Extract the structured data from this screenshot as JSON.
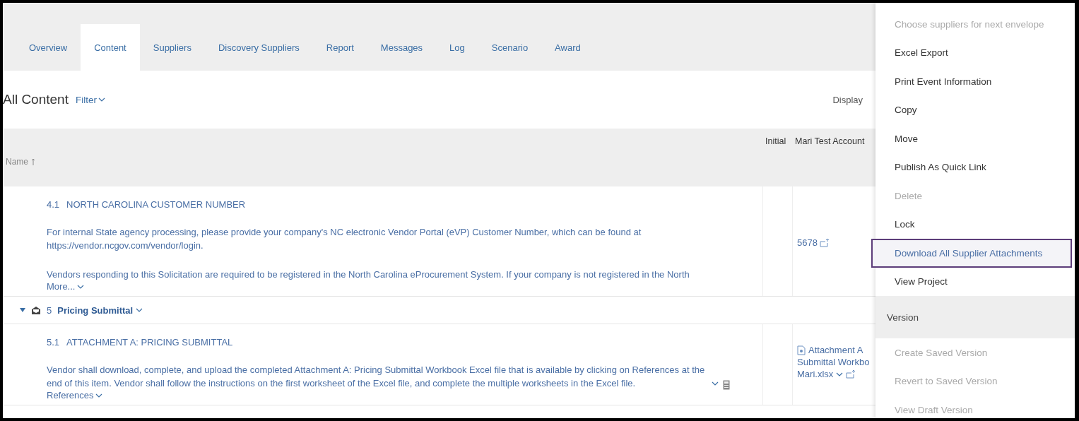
{
  "tabs": [
    {
      "label": "Overview",
      "selected": false
    },
    {
      "label": "Content",
      "selected": true
    },
    {
      "label": "Suppliers",
      "selected": false
    },
    {
      "label": "Discovery Suppliers",
      "selected": false
    },
    {
      "label": "Report",
      "selected": false
    },
    {
      "label": "Messages",
      "selected": false
    },
    {
      "label": "Log",
      "selected": false
    },
    {
      "label": "Scenario",
      "selected": false
    },
    {
      "label": "Award",
      "selected": false
    }
  ],
  "heading": {
    "title": "All Content",
    "filter": "Filter",
    "display": "Display"
  },
  "table": {
    "columns": [
      "Initial",
      "Mari Test Account"
    ],
    "name_header": "Name",
    "rows": [
      {
        "kind": "item",
        "number": "4.1",
        "title": "NORTH CAROLINA CUSTOMER NUMBER",
        "paragraphs": [
          "For internal State agency processing, please provide your company's NC electronic Vendor Portal (eVP) Customer Number, which can be found at https://vendor.ncgov.com/vendor/login.",
          "Vendors responding to this Solicitation are required to be registered in the North Carolina eProcurement System. If your company is not registered in the North"
        ],
        "link": "More...",
        "value": "5678"
      },
      {
        "kind": "section",
        "number": "5",
        "title": "Pricing Submittal",
        "expanded": true
      },
      {
        "kind": "item",
        "number": "5.1",
        "title": "ATTACHMENT A: PRICING SUBMITTAL",
        "paragraphs": [
          "Vendor shall download, complete, and upload the completed Attachment A: Pricing Submittal Workbook Excel file that is available by clicking on References at the end of this item. Vendor shall follow the instructions on the first worksheet of the Excel file, and complete the multiple worksheets in the Excel file."
        ],
        "link": "References",
        "attachment": [
          "Attachment A",
          "Submittal Workbo",
          "Mari.xlsx"
        ]
      }
    ]
  },
  "menu": [
    {
      "kind": "item",
      "label": "Choose suppliers for next envelope",
      "disabled": true,
      "selected": false
    },
    {
      "kind": "item",
      "label": "Excel Export",
      "disabled": false,
      "selected": false
    },
    {
      "kind": "item",
      "label": "Print Event Information",
      "disabled": false,
      "selected": false
    },
    {
      "kind": "item",
      "label": "Copy",
      "disabled": false,
      "selected": false
    },
    {
      "kind": "item",
      "label": "Move",
      "disabled": false,
      "selected": false
    },
    {
      "kind": "item",
      "label": "Publish As Quick Link",
      "disabled": false,
      "selected": false
    },
    {
      "kind": "item",
      "label": "Delete",
      "disabled": true,
      "selected": false
    },
    {
      "kind": "item",
      "label": "Lock",
      "disabled": false,
      "selected": false
    },
    {
      "kind": "item",
      "label": "Download All Supplier Attachments",
      "disabled": false,
      "selected": true
    },
    {
      "kind": "item",
      "label": "View Project",
      "disabled": false,
      "selected": false
    },
    {
      "kind": "header",
      "label": "Version"
    },
    {
      "kind": "item",
      "label": "Create Saved Version",
      "disabled": true,
      "selected": false
    },
    {
      "kind": "item",
      "label": "Revert to Saved Version",
      "disabled": true,
      "selected": false
    },
    {
      "kind": "item",
      "label": "View Draft Version",
      "disabled": true,
      "selected": false
    }
  ]
}
